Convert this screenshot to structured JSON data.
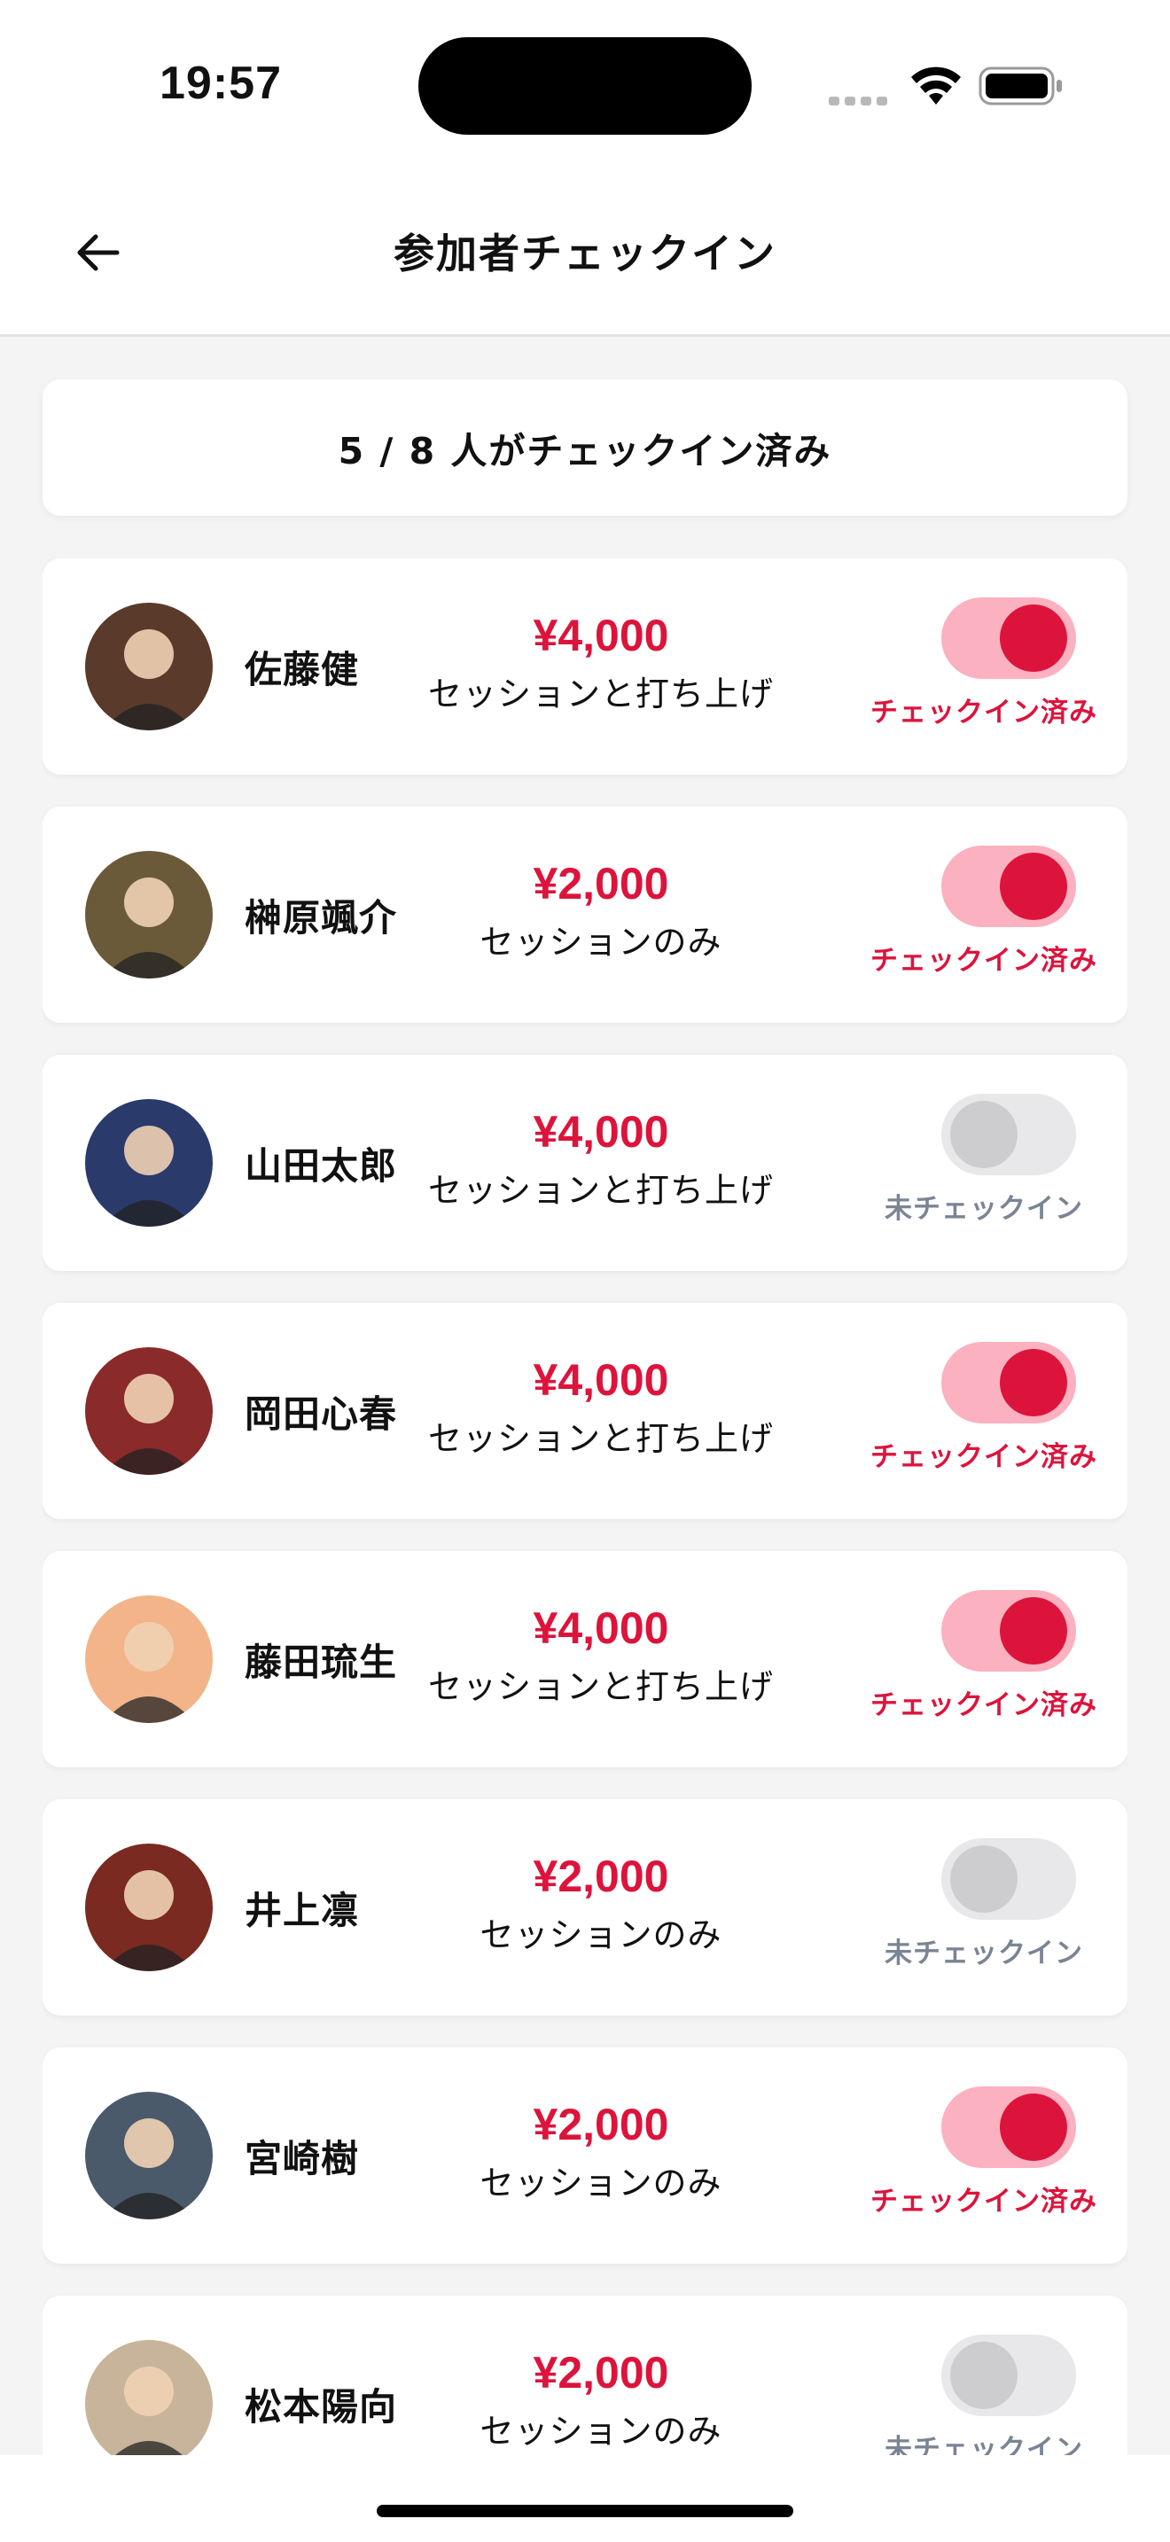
{
  "status_bar": {
    "time": "19:57"
  },
  "header": {
    "title": "参加者チェックイン",
    "back_icon": "arrow-left-icon"
  },
  "summary": {
    "text": "5 / 8 人がチェックイン済み"
  },
  "colors": {
    "accent": "#dc143c",
    "toggle_on_track": "#fbb1bf",
    "toggle_off_track": "#e8e8ea",
    "muted": "#7a8494"
  },
  "participants": [
    {
      "name": "佐藤健",
      "price": "¥4,000",
      "plan": "セッションと打ち上げ",
      "checked_in": true,
      "status": "チェックイン済み",
      "avatar_color": "#5a3a2a"
    },
    {
      "name": "榊原颯介",
      "price": "¥2,000",
      "plan": "セッションのみ",
      "checked_in": true,
      "status": "チェックイン済み",
      "avatar_color": "#6b5a3a"
    },
    {
      "name": "山田太郎",
      "price": "¥4,000",
      "plan": "セッションと打ち上げ",
      "checked_in": false,
      "status": "未チェックイン",
      "avatar_color": "#2a3a6b"
    },
    {
      "name": "岡田心春",
      "price": "¥4,000",
      "plan": "セッションと打ち上げ",
      "checked_in": true,
      "status": "チェックイン済み",
      "avatar_color": "#8b2a2a"
    },
    {
      "name": "藤田琉生",
      "price": "¥4,000",
      "plan": "セッションと打ち上げ",
      "checked_in": true,
      "status": "チェックイン済み",
      "avatar_color": "#f2b488"
    },
    {
      "name": "井上凛",
      "price": "¥2,000",
      "plan": "セッションのみ",
      "checked_in": false,
      "status": "未チェックイン",
      "avatar_color": "#7a2a20"
    },
    {
      "name": "宮崎樹",
      "price": "¥2,000",
      "plan": "セッションのみ",
      "checked_in": true,
      "status": "チェックイン済み",
      "avatar_color": "#4a5a6a"
    },
    {
      "name": "松本陽向",
      "price": "¥2,000",
      "plan": "セッションのみ",
      "checked_in": false,
      "status": "未チェックイン",
      "avatar_color": "#c8b49a"
    }
  ]
}
